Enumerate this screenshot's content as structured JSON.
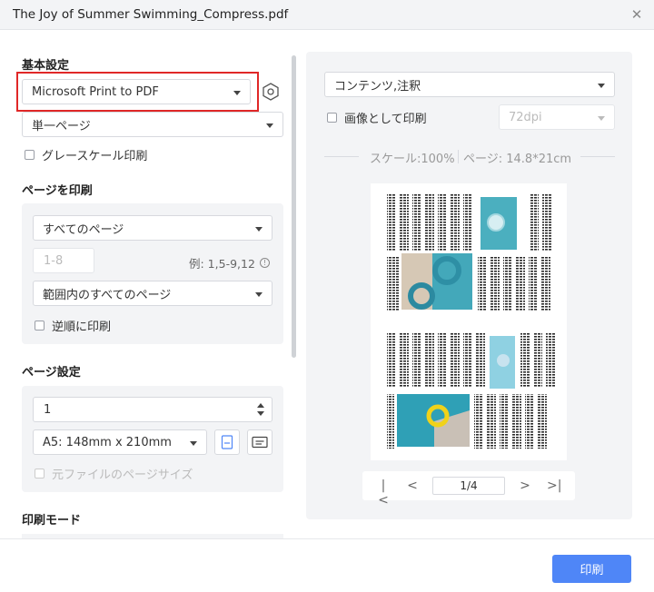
{
  "window": {
    "title": "The Joy of Summer Swimming_Compress.pdf"
  },
  "basic": {
    "heading": "基本設定",
    "printer": "Microsoft Print to PDF",
    "layout": "単一ページ",
    "grayscale_label": "グレースケール印刷"
  },
  "print_pages": {
    "heading": "ページを印刷",
    "range_select": "すべてのページ",
    "range_placeholder": "1-8",
    "range_hint": "例: 1,5-9,12",
    "subset_select": "範囲内のすべてのページ",
    "reverse_label": "逆順に印刷"
  },
  "page_setup": {
    "heading": "ページ設定",
    "copies": "1",
    "paper_size": "A5: 148mm x 210mm",
    "original_size_label": "元ファイルのページサイズ"
  },
  "print_mode": {
    "heading": "印刷モード"
  },
  "preview": {
    "content_select": "コンテンツ,注釈",
    "as_image_label": "画像として印刷",
    "dpi": "72dpi",
    "scale_text": "スケール:100%",
    "page_size_text": "ページ: 14.8*21cm",
    "current_page": "1/4"
  },
  "footer": {
    "print_label": "印刷"
  },
  "colors": {
    "accent": "#4f86f7",
    "highlight": "#e02727"
  }
}
